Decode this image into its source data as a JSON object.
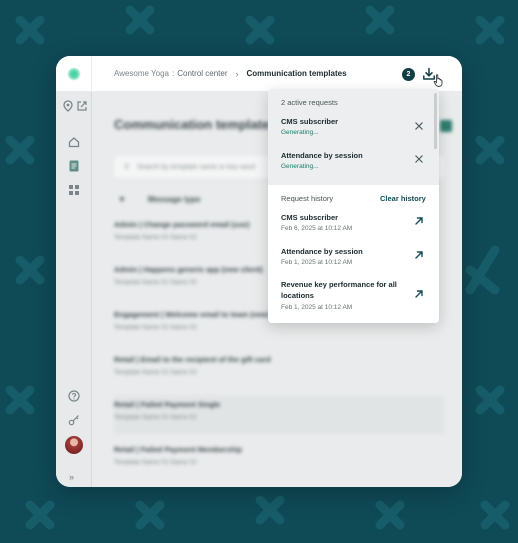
{
  "colors": {
    "background": "#0f4a57",
    "accent": "#123e46",
    "status": "#1e7a6a"
  },
  "breadcrumb": {
    "workspace": "Awesome Yoga",
    "separator": ":",
    "section": "Control center",
    "current": "Communication templates"
  },
  "downloads": {
    "badge_count": "2",
    "icon": "download-icon"
  },
  "sidebar": {
    "items": [
      {
        "icon": "location-pin-icon"
      },
      {
        "icon": "external-link-icon"
      },
      {
        "icon": "home-icon"
      },
      {
        "icon": "document-icon"
      },
      {
        "icon": "grid-icon"
      },
      {
        "icon": "help-icon"
      },
      {
        "icon": "key-icon"
      },
      {
        "icon": "avatar"
      },
      {
        "icon": "expand-icon",
        "label": "»"
      }
    ]
  },
  "main": {
    "title": "Communication templates",
    "search_placeholder": "Search by template name or key word",
    "column_header": "Message type",
    "rows": [
      {
        "title": "Admin  |  Change password email (use)",
        "sub": "Template Name 01  Name 02"
      },
      {
        "title": "Admin  |  Happens generic app (new client)",
        "sub": "Template Name 01  Name 02"
      },
      {
        "title": "Engagement  |  Welcome email to team (new)",
        "sub": "Template Name 01  Name 02"
      },
      {
        "title": "Retail  |  Email to the recipient of the gift card",
        "sub": "Template Name 01  Name 02"
      },
      {
        "title": "Retail  |  Failed Payment Single",
        "sub": "Template Name 01  Name 02"
      },
      {
        "title": "Retail  |  Failed Payment Membership",
        "sub": "Template Name 01  Name 02"
      }
    ]
  },
  "panel": {
    "active_heading": "2 active requests",
    "active": [
      {
        "title": "CMS subscriber",
        "status": "Generating..."
      },
      {
        "title": "Attendance by session",
        "status": "Generating..."
      }
    ],
    "history_heading": "Request history",
    "clear_label": "Clear history",
    "history": [
      {
        "title": "CMS subscriber",
        "date": "Feb 6, 2025 at 10:12 AM"
      },
      {
        "title": "Attendance by session",
        "date": "Feb 1, 2025 at 10:12 AM"
      },
      {
        "title_line1": "Revenue key performance for all",
        "title_line2": "locations",
        "date": "Feb 1, 2025 at 10:12 AM"
      }
    ]
  }
}
